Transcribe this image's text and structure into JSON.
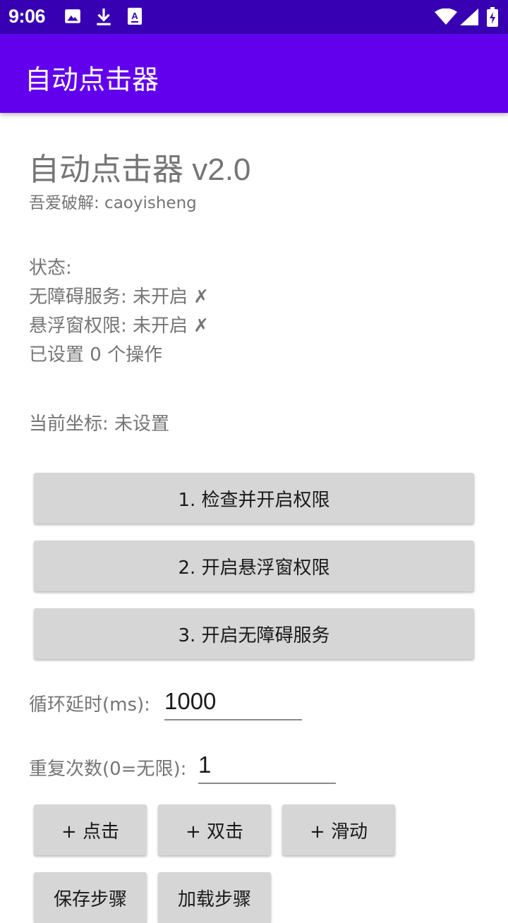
{
  "status_bar": {
    "time": "9:06",
    "left_icons": [
      "image-icon",
      "download-icon",
      "text-notification-icon"
    ],
    "right_icons": [
      "wifi-icon",
      "signal-icon",
      "battery-icon"
    ]
  },
  "app_bar": {
    "title": "自动点击器"
  },
  "header": {
    "title": "自动点击器 v2.0",
    "subtitle": "吾爱破解: caoyisheng"
  },
  "status": {
    "label": "状态:",
    "accessibility": "无障碍服务: 未开启 ✗",
    "overlay": "悬浮窗权限: 未开启 ✗",
    "actions_count": "已设置 0 个操作"
  },
  "coordinates": {
    "text": "当前坐标: 未设置"
  },
  "buttons": {
    "check_permissions": "1. 检查并开启权限",
    "overlay_permission": "2. 开启悬浮窗权限",
    "accessibility_service": "3. 开启无障碍服务"
  },
  "settings": {
    "loop_delay_label": "循环延时(ms):",
    "loop_delay_value": "1000",
    "repeat_label": "重复次数(0=无限):",
    "repeat_value": "1"
  },
  "actions": {
    "add_click": "+ 点击",
    "add_double_click": "+ 双击",
    "add_swipe": "+ 滑动",
    "save_steps": "保存步骤",
    "load_steps": "加载步骤"
  },
  "colors": {
    "status_bar": "#3700b3",
    "app_bar": "#6200ee",
    "button": "#d6d6d6",
    "secondary_text": "#757575"
  }
}
